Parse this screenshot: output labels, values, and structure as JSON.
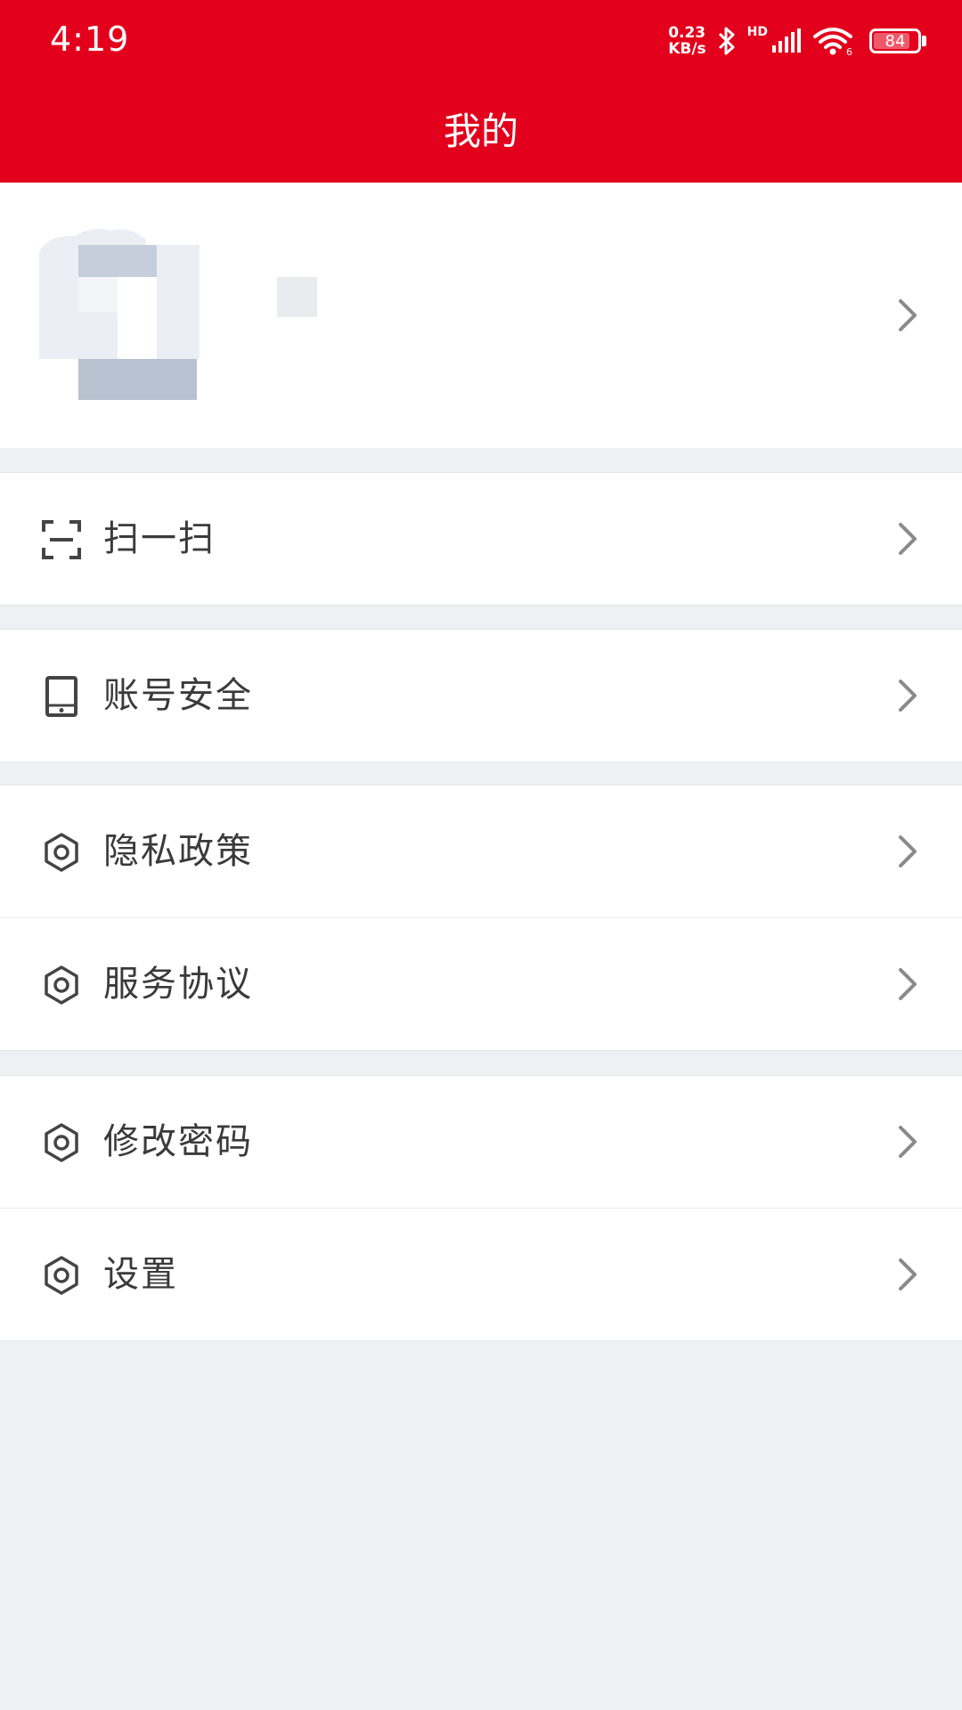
{
  "status_bar": {
    "time": "4:19",
    "net_speed_value": "0.23",
    "net_speed_unit": "KB/s",
    "hd_label": "HD",
    "wifi_badge": "6",
    "battery": "84",
    "battery_level": 0.84
  },
  "header": {
    "title": "我的"
  },
  "profile": {
    "avatar": "avatar-image",
    "name": ""
  },
  "menu_groups": [
    {
      "items": [
        {
          "icon": "scan-icon",
          "label": "扫一扫"
        }
      ]
    },
    {
      "items": [
        {
          "icon": "tablet-icon",
          "label": "账号安全"
        }
      ]
    },
    {
      "items": [
        {
          "icon": "gear-icon",
          "label": "隐私政策"
        },
        {
          "icon": "gear-icon",
          "label": "服务协议"
        }
      ]
    },
    {
      "items": [
        {
          "icon": "gear-icon",
          "label": "修改密码"
        },
        {
          "icon": "gear-icon",
          "label": "设置"
        }
      ]
    }
  ],
  "colors": {
    "brand_red": "#e3001c",
    "background": "#eff0f4",
    "text": "#3a3a3a",
    "chevron": "#8a8a8a"
  }
}
